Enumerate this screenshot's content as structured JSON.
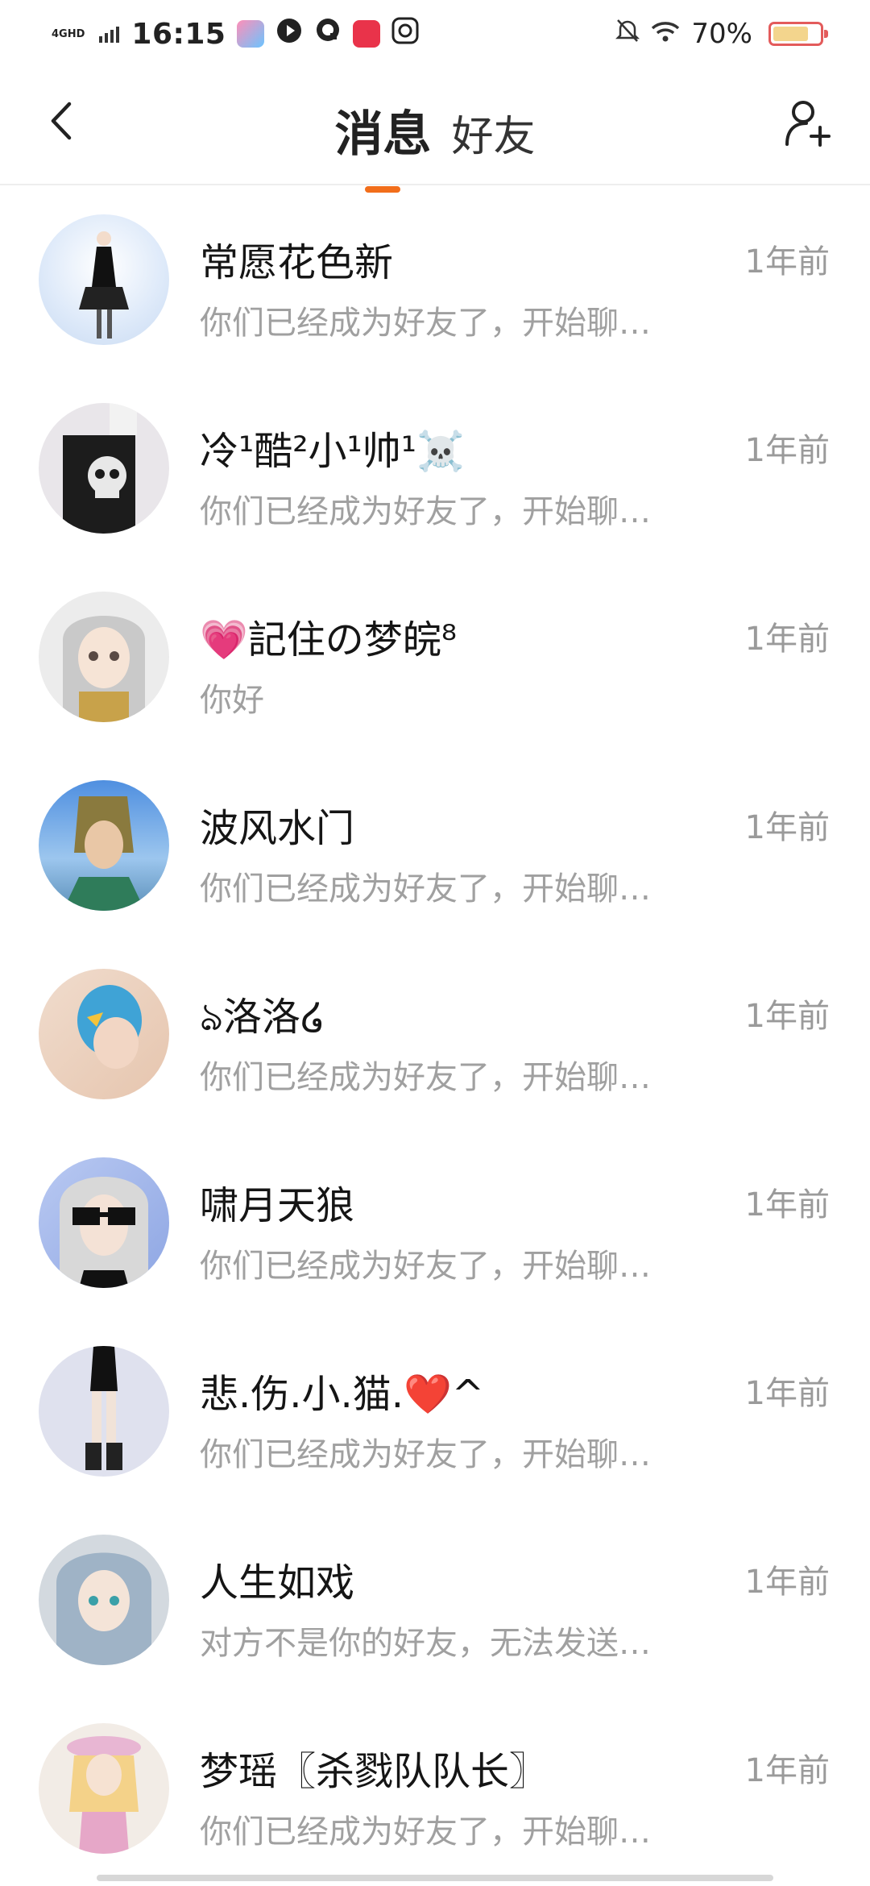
{
  "status": {
    "network": "4GHD",
    "time": "16:15",
    "battery": "70%"
  },
  "nav": {
    "tab_messages": "消息",
    "tab_friends": "好友",
    "accent": "#f26e1b"
  },
  "rows": [
    {
      "name": "常愿花色新",
      "msg": "你们已经成为好友了，开始聊…",
      "time": "1年前",
      "avatar_color": "#cfe0f5"
    },
    {
      "name": "冷¹酷²小¹帅¹☠️",
      "msg": "你们已经成为好友了，开始聊…",
      "time": "1年前",
      "avatar_color": "#222222"
    },
    {
      "name": "💗記住の梦皖⁸",
      "msg": "你好",
      "time": "1年前",
      "avatar_color": "#d8d6d6"
    },
    {
      "name": "波风水门",
      "msg": "你们已经成为好友了，开始聊…",
      "time": "1年前",
      "avatar_color": "#6aa0d6"
    },
    {
      "name": "ঌ洛洛໒",
      "msg": "你们已经成为好友了，开始聊…",
      "time": "1年前",
      "avatar_color": "#e4c3ad"
    },
    {
      "name": "啸月天狼",
      "msg": "你们已经成为好友了，开始聊…",
      "time": "1年前",
      "avatar_color": "#9fb5e6"
    },
    {
      "name": "悲.伤.小.猫.❤️^",
      "msg": "你们已经成为好友了，开始聊…",
      "time": "1年前",
      "avatar_color": "#d9dcee"
    },
    {
      "name": "人生如戏",
      "msg": "对方不是你的好友，无法发送…",
      "time": "1年前",
      "avatar_color": "#b7c4cf"
    },
    {
      "name": "梦瑶〖杀戮队队长〗",
      "msg": "你们已经成为好友了，开始聊…",
      "time": "1年前",
      "avatar_color": "#f1e8d8"
    }
  ]
}
